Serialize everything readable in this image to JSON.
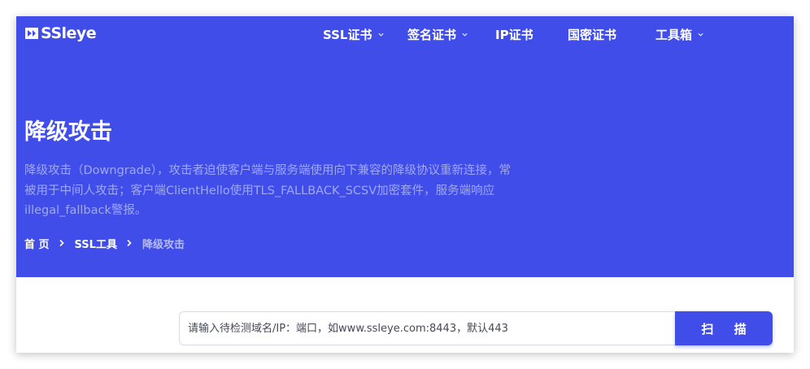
{
  "brand": {
    "name": "SSleye",
    "logo_icon": "ssl-logo-mark-icon"
  },
  "nav": {
    "items": [
      {
        "label": "SSL证书",
        "has_dropdown": true
      },
      {
        "label": "签名证书",
        "has_dropdown": true
      },
      {
        "label": "IP证书",
        "has_dropdown": false
      },
      {
        "label": "国密证书",
        "has_dropdown": false
      },
      {
        "label": "工具箱",
        "has_dropdown": true
      }
    ],
    "dropdown_icon": "chevron-down-icon"
  },
  "hero": {
    "title": "降级攻击",
    "description": "降级攻击（Downgrade），攻击者迫使客户端与服务端使用向下兼容的降级协议重新连接，常被用于中间人攻击；客户端ClientHello使用TLS_FALLBACK_SCSV加密套件，服务端响应illegal_fallback警报。",
    "background_color": "#414de8",
    "description_color": "#9ea8f5"
  },
  "breadcrumb": {
    "items": [
      "首 页",
      "SSL工具",
      "降级攻击"
    ],
    "separator_icon": "chevron-right-icon"
  },
  "search": {
    "placeholder": "请输入待检测域名/IP：端口，如www.ssleye.com:8443，默认443",
    "value": "",
    "button_label": "扫 描"
  }
}
